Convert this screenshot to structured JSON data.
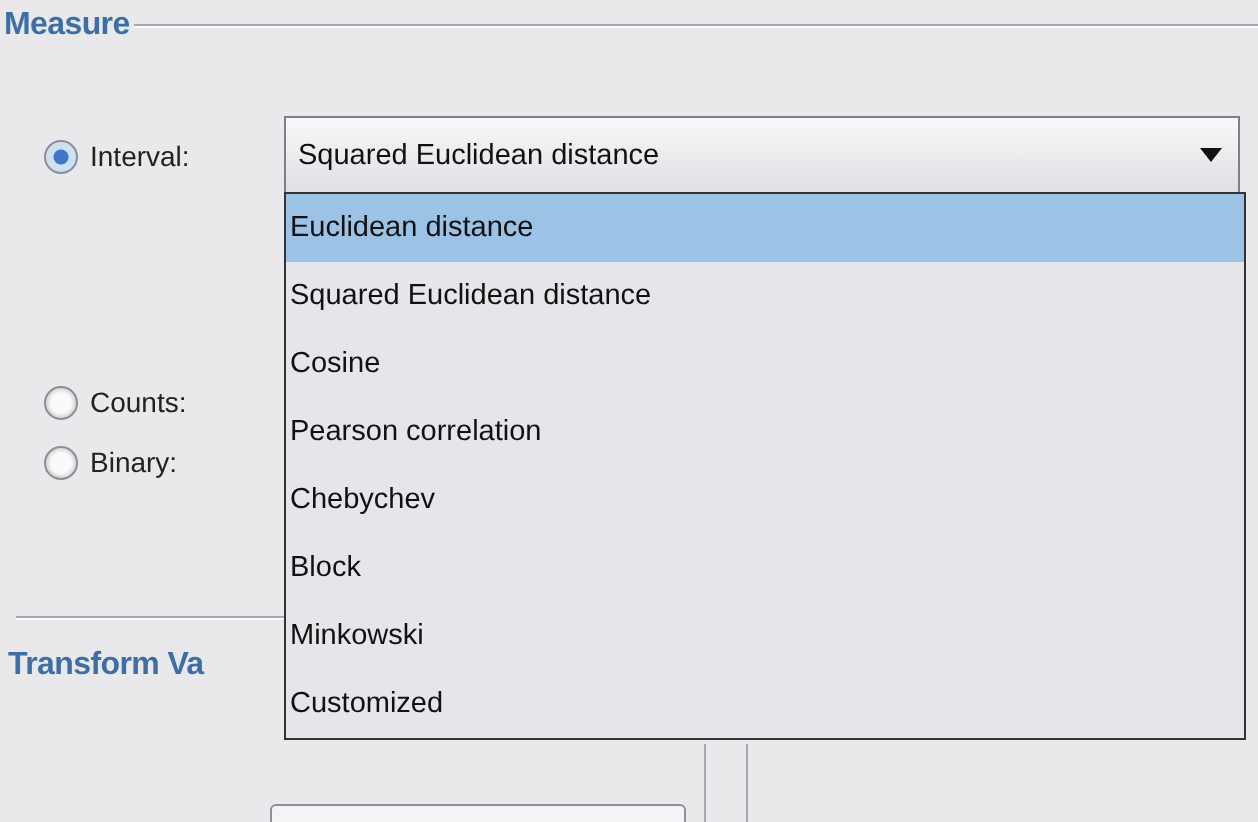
{
  "measure": {
    "title": "Measure",
    "options": [
      {
        "label": "Interval:",
        "selected": true
      },
      {
        "label": "Counts:",
        "selected": false
      },
      {
        "label": "Binary:",
        "selected": false
      }
    ],
    "combo": {
      "value": "Squared Euclidean distance",
      "expanded": true,
      "items": [
        {
          "label": "Euclidean distance",
          "highlighted": true
        },
        {
          "label": "Squared Euclidean distance",
          "highlighted": false
        },
        {
          "label": "Cosine",
          "highlighted": false
        },
        {
          "label": "Pearson correlation",
          "highlighted": false
        },
        {
          "label": "Chebychev",
          "highlighted": false
        },
        {
          "label": "Block",
          "highlighted": false
        },
        {
          "label": "Minkowski",
          "highlighted": false
        },
        {
          "label": "Customized",
          "highlighted": false
        }
      ]
    }
  },
  "transform_values": {
    "title": "Transform Va"
  }
}
